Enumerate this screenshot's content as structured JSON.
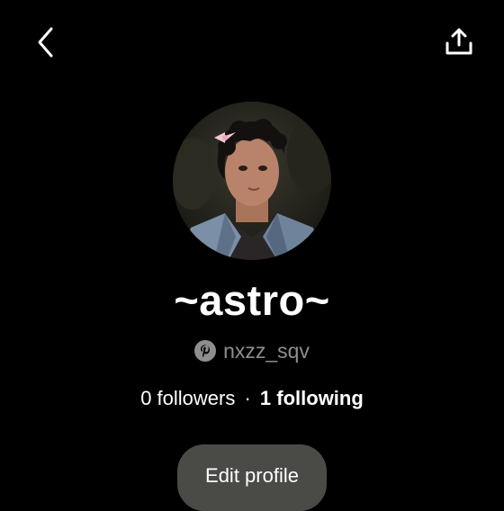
{
  "header": {
    "back_icon": "chevron-left-icon",
    "share_icon": "share-upload-icon"
  },
  "profile": {
    "avatar": "profile-photo",
    "display_name": "~astro~",
    "username": "nxzz_sqv",
    "username_icon": "pinterest-icon",
    "followers": "0 followers",
    "separator": "·",
    "following": "1 following",
    "edit_button_label": "Edit profile"
  },
  "colors": {
    "background": "#000000",
    "text_primary": "#ffffff",
    "text_secondary": "#8e8e8e",
    "button_background": "#4a4a47"
  }
}
